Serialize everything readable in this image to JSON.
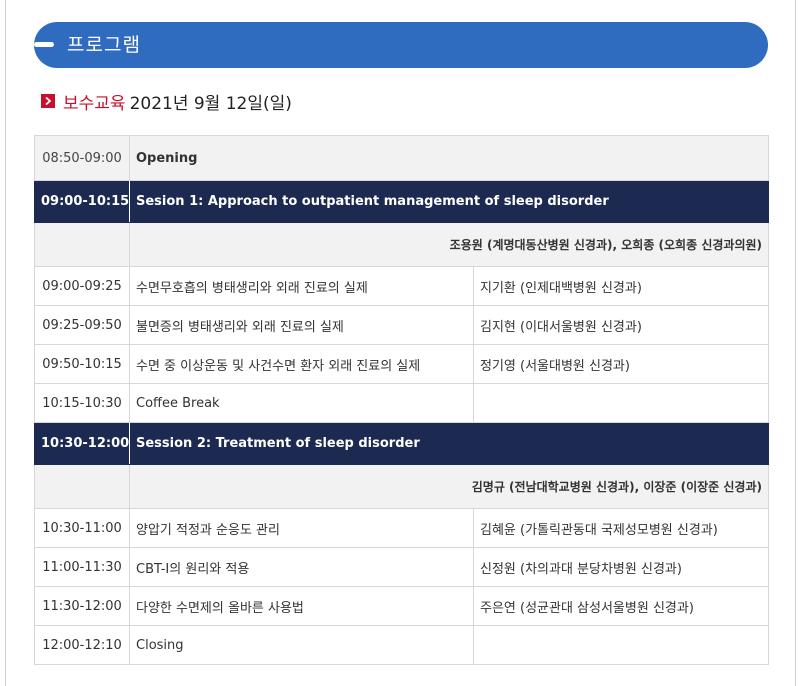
{
  "header": {
    "title": "프로그램"
  },
  "subtitle": {
    "label": "보수교육",
    "date": "2021년 9월 12일(일)"
  },
  "rows": {
    "opening": {
      "time": "08:50-09:00",
      "title": "Opening"
    },
    "session1": {
      "time": "09:00-10:15",
      "title": "Sesion 1: Approach to outpatient management of sleep disorder"
    },
    "chair1": "조용원 (계명대동산병원 신경과), 오희종 (오희종 신경과의원)",
    "talk1": {
      "time": "09:00-09:25",
      "title": "수면무호흡의 병태생리와 외래 진료의 실제",
      "speaker": "지기환 (인제대백병원 신경과)"
    },
    "talk2": {
      "time": "09:25-09:50",
      "title": "불면증의 병태생리와 외래 진료의 실제",
      "speaker": "김지현 (이대서울병원 신경과)"
    },
    "talk3": {
      "time": "09:50-10:15",
      "title": "수면 중 이상운동 및 사건수면 환자 외래 진료의 실제",
      "speaker": "정기영 (서울대병원 신경과)"
    },
    "break": {
      "time": "10:15-10:30",
      "title": "Coffee Break"
    },
    "session2": {
      "time": "10:30-12:00",
      "title": "Session 2: Treatment of sleep disorder"
    },
    "chair2": "김명규 (전남대학교병원 신경과), 이장준 (이장준 신경과)",
    "talk4": {
      "time": "10:30-11:00",
      "title": "양압기 적정과 순응도 관리",
      "speaker": "김혜윤 (가톨릭관동대 국제성모병원 신경과)"
    },
    "talk5": {
      "time": "11:00-11:30",
      "title": "CBT-I의 원리와 적용",
      "speaker": "신정원 (차의과대 분당차병원 신경과)"
    },
    "talk6": {
      "time": "11:30-12:00",
      "title": "다양한 수면제의 올바른 사용법",
      "speaker": "주은연 (성균관대 삼성서울병원 신경과)"
    },
    "closing": {
      "time": "12:00-12:10",
      "title": "Closing"
    }
  }
}
